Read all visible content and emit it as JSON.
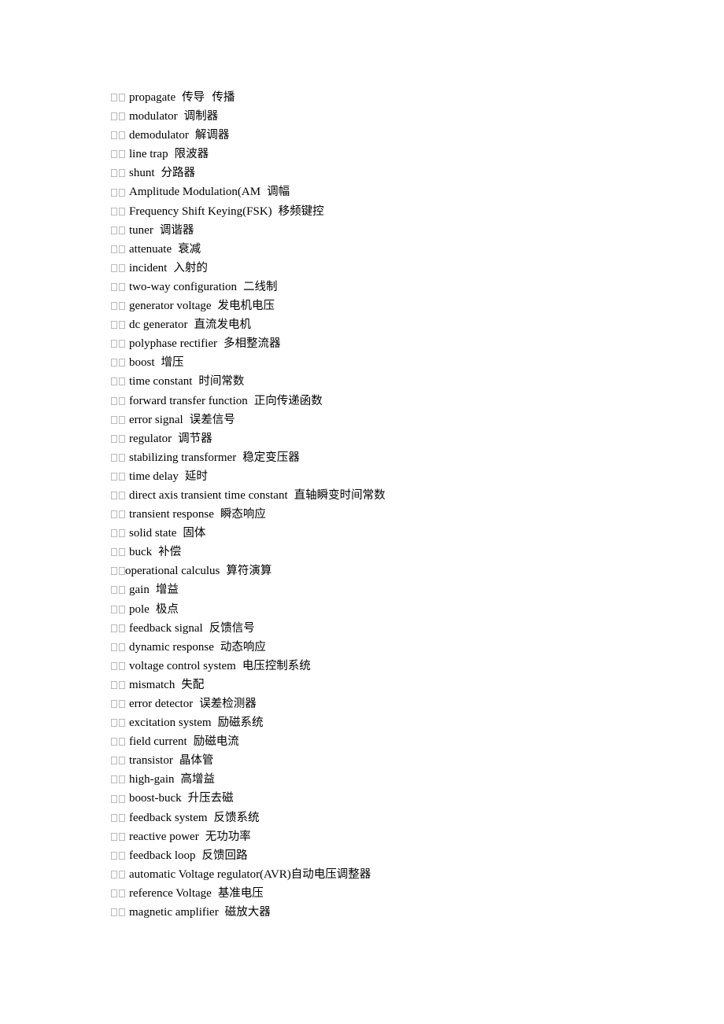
{
  "document": {
    "entries": [
      {
        "term": "propagate",
        "translation": "传导  传播"
      },
      {
        "term": "modulator",
        "translation": "调制器"
      },
      {
        "term": "demodulator",
        "translation": "解调器"
      },
      {
        "term": "line trap",
        "translation": "限波器"
      },
      {
        "term": "shunt",
        "translation": "分路器"
      },
      {
        "term": "Amplitude Modulation(AM",
        "translation": "调幅"
      },
      {
        "term": "Frequency Shift Keying(FSK)",
        "translation": "移频键控"
      },
      {
        "term": "tuner",
        "translation": "调谐器"
      },
      {
        "term": "attenuate",
        "translation": "衰减"
      },
      {
        "term": "incident",
        "translation": "入射的"
      },
      {
        "term": "two-way configuration",
        "translation": "二线制"
      },
      {
        "term": "generator voltage",
        "translation": "发电机电压"
      },
      {
        "term": "dc generator",
        "translation": "直流发电机"
      },
      {
        "term": "polyphase rectifier",
        "translation": "多相整流器"
      },
      {
        "term": "boost",
        "translation": "增压"
      },
      {
        "term": "time constant",
        "translation": "时间常数"
      },
      {
        "term": "forward transfer function",
        "translation": "正向传递函数"
      },
      {
        "term": "error signal",
        "translation": "误差信号"
      },
      {
        "term": "regulator",
        "translation": "调节器"
      },
      {
        "term": "stabilizing transformer",
        "translation": "稳定变压器"
      },
      {
        "term": "time delay",
        "translation": "延时"
      },
      {
        "term": "direct axis transient time constant",
        "translation": "直轴瞬变时间常数"
      },
      {
        "term": "transient response",
        "translation": "瞬态响应"
      },
      {
        "term": "solid state",
        "translation": "固体"
      },
      {
        "term": "buck",
        "translation": "补偿"
      },
      {
        "term": "operational calculus",
        "translation": "算符演算"
      },
      {
        "term": "gain",
        "translation": "增益"
      },
      {
        "term": "pole",
        "translation": "极点"
      },
      {
        "term": "feedback signal",
        "translation": "反馈信号"
      },
      {
        "term": "dynamic response",
        "translation": "动态响应"
      },
      {
        "term": "voltage control system",
        "translation": "电压控制系统"
      },
      {
        "term": "mismatch",
        "translation": "失配"
      },
      {
        "term": "error detector",
        "translation": "误差检测器"
      },
      {
        "term": "excitation system",
        "translation": "励磁系统"
      },
      {
        "term": "field current",
        "translation": "励磁电流"
      },
      {
        "term": "transistor",
        "translation": "晶体管"
      },
      {
        "term": "high-gain",
        "translation": "高增益"
      },
      {
        "term": "boost-buck",
        "translation": "升压去磁"
      },
      {
        "term": "feedback system",
        "translation": "反馈系统"
      },
      {
        "term": "reactive power",
        "translation": "无功功率"
      },
      {
        "term": "feedback loop",
        "translation": "反馈回路"
      },
      {
        "term": "automatic Voltage regulator(AVR)",
        "translation": "自动电压调整器"
      },
      {
        "term": "reference Voltage",
        "translation": "基准电压"
      },
      {
        "term": "magnetic amplifier",
        "translation": "磁放大器"
      }
    ]
  }
}
